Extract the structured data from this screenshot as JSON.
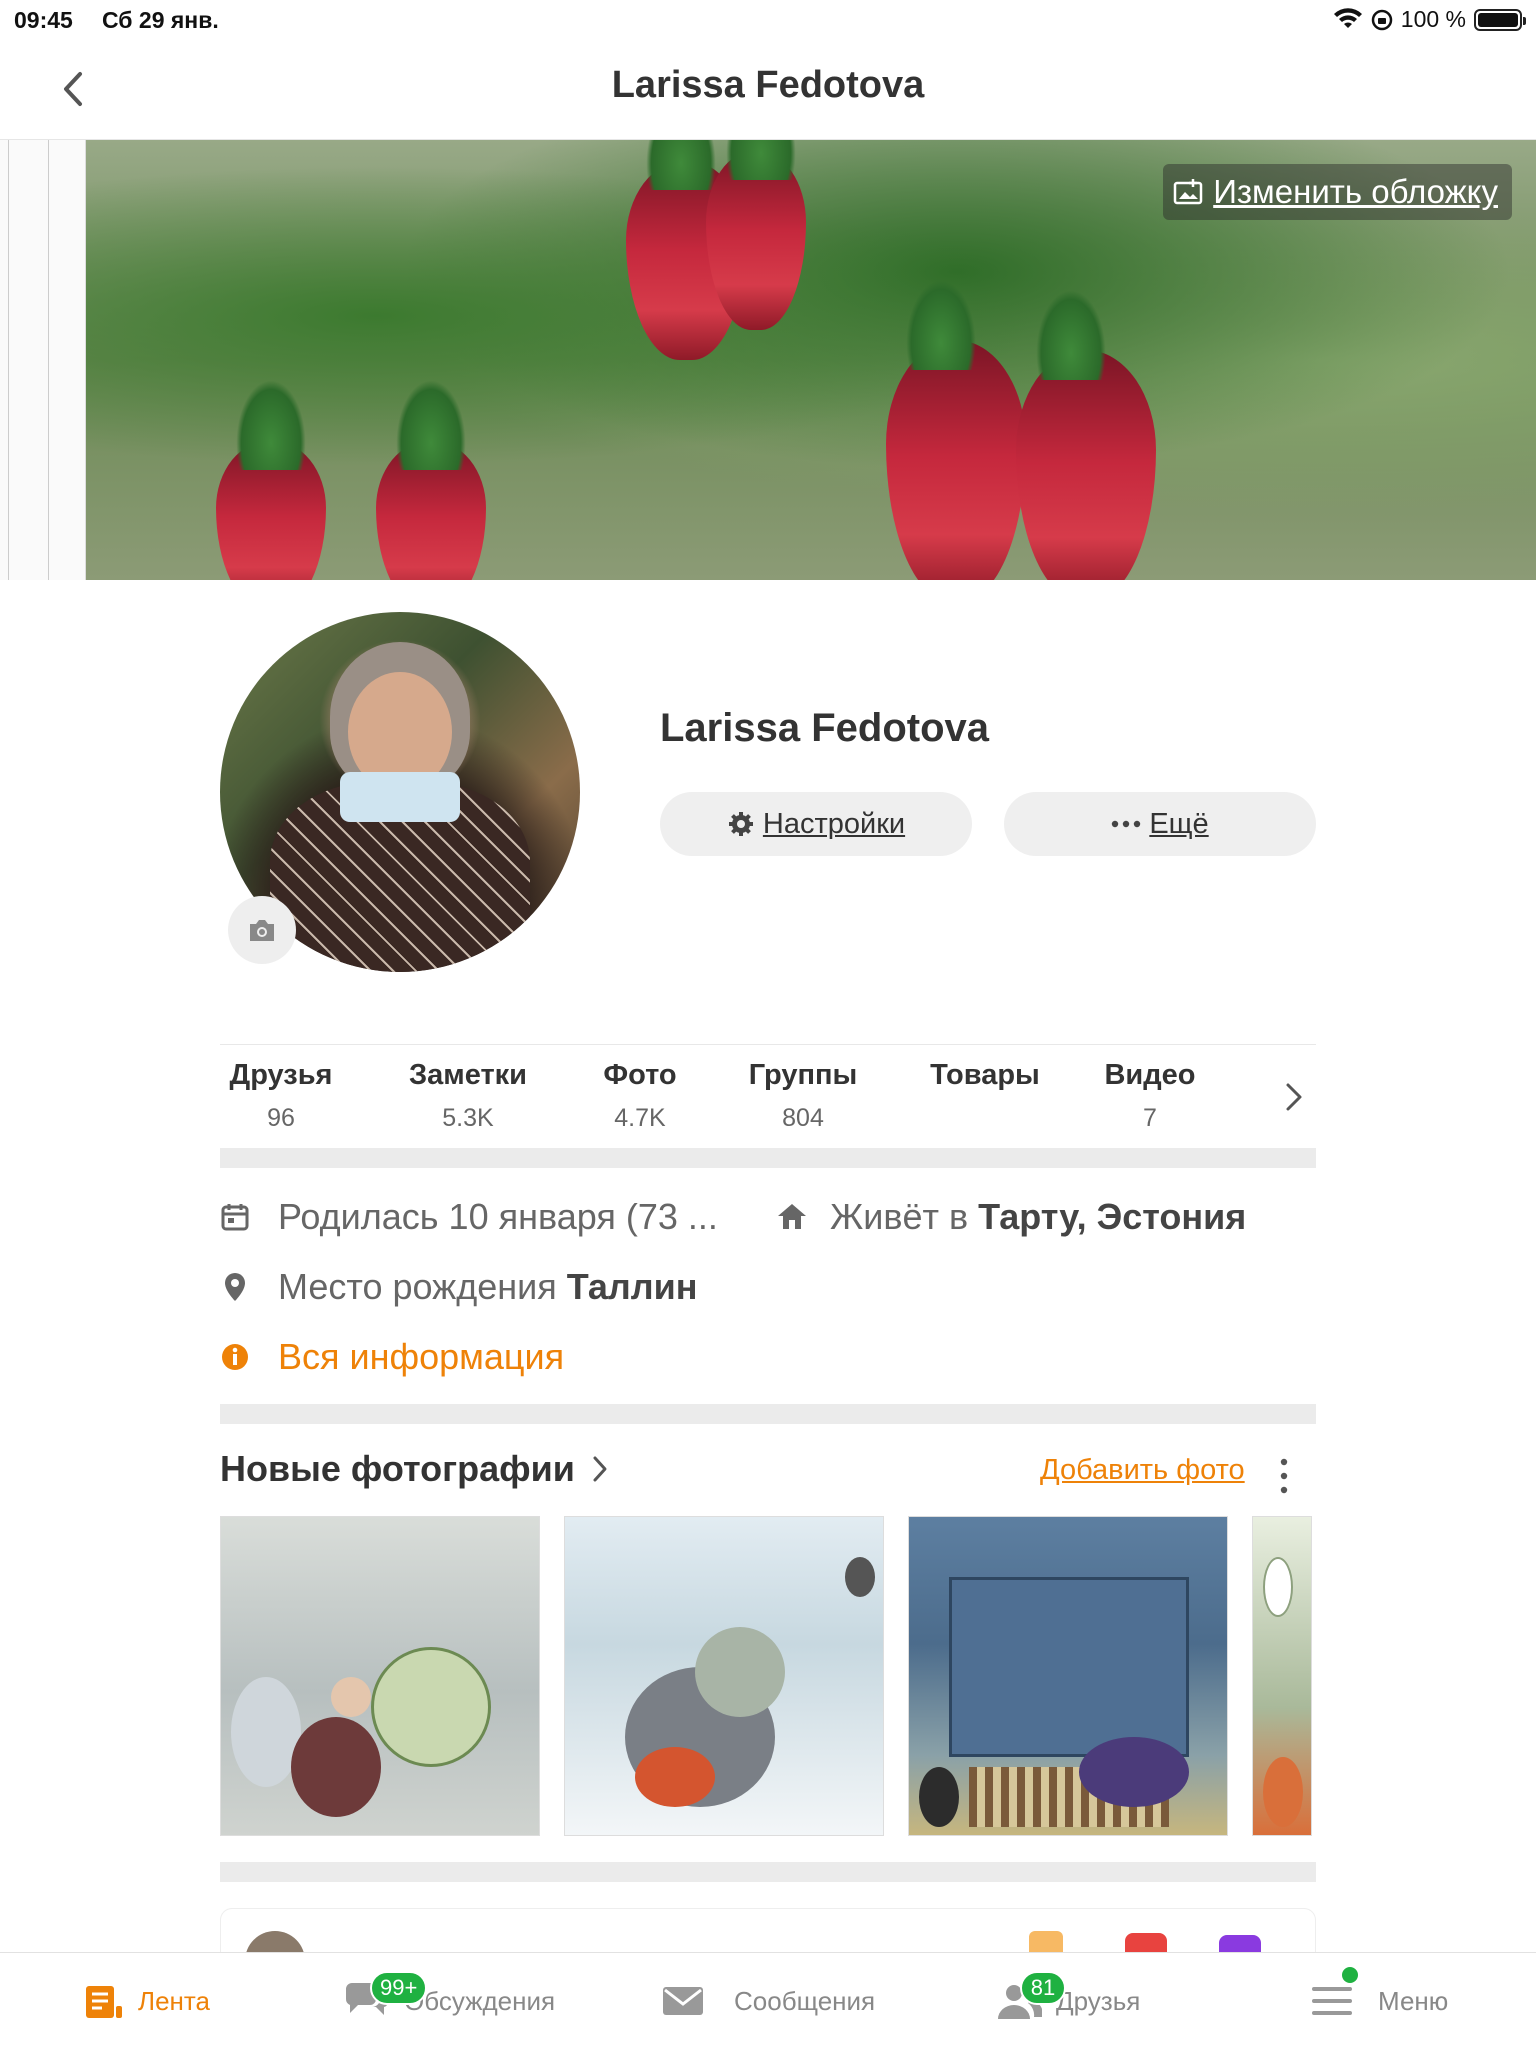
{
  "status_bar": {
    "time": "09:45",
    "date": "Сб 29 янв.",
    "battery": "100 %"
  },
  "nav": {
    "title": "Larissa Fedotova",
    "back_icon": "chevron-left-icon"
  },
  "cover": {
    "change_cover_label": "Изменить обложку"
  },
  "profile": {
    "name": "Larissa Fedotova",
    "settings_label": "Настройки",
    "more_label": "Ещё"
  },
  "stats": [
    {
      "label": "Друзья",
      "value": "96"
    },
    {
      "label": "Заметки",
      "value": "5.3K"
    },
    {
      "label": "Фото",
      "value": "4.7K"
    },
    {
      "label": "Группы",
      "value": "804"
    },
    {
      "label": "Товары",
      "value": ""
    },
    {
      "label": "Видео",
      "value": "7"
    }
  ],
  "info": {
    "birth": "Родилась 10 января (73 ...",
    "lives_prefix": "Живёт в",
    "lives_place": "Тарту, Эстония",
    "birthplace_prefix": "Место рождения",
    "birthplace": "Таллин",
    "all_info": "Вся информация"
  },
  "photos": {
    "title": "Новые фотографии",
    "add_label": "Добавить фото"
  },
  "tabbar": {
    "items": [
      {
        "label": "Лента",
        "icon": "feed-icon",
        "active": true
      },
      {
        "label": "Обсуждения",
        "icon": "discussions-icon",
        "badge": "99+"
      },
      {
        "label": "Сообщения",
        "icon": "messages-icon"
      },
      {
        "label": "Друзья",
        "icon": "friends-icon",
        "badge": "81"
      },
      {
        "label": "Меню",
        "icon": "menu-icon",
        "dot": true
      }
    ]
  },
  "colors": {
    "accent": "#ee8208",
    "badge": "#1fb141",
    "divider": "#ebebeb"
  }
}
